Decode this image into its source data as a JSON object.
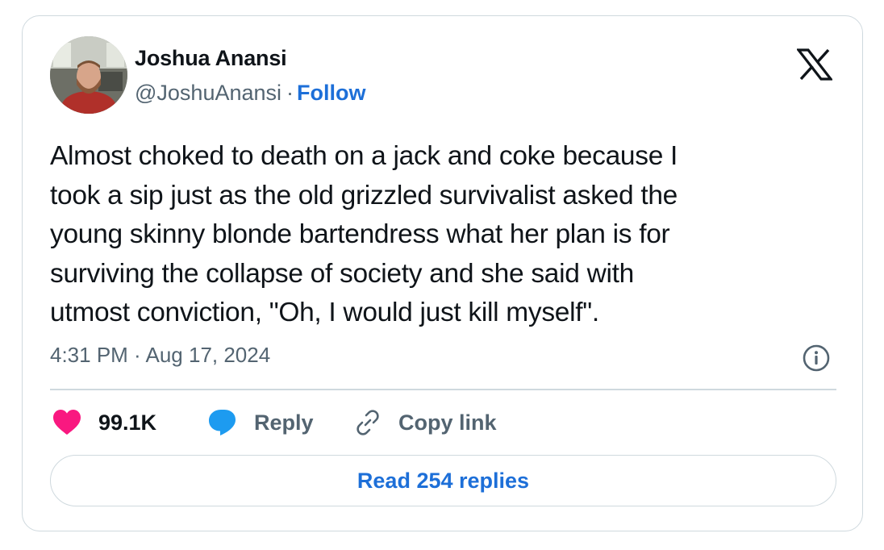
{
  "tweet": {
    "author": {
      "name": "Joshua Anansi",
      "handle": "@JoshuAnansi",
      "separator": "·",
      "follow_label": "Follow",
      "avatar_icon": "profile-photo"
    },
    "platform_icon": "x-logo-icon",
    "text": "Almost choked to death on a jack and coke because I\ntook a sip just as the old grizzled survivalist asked the\nyoung skinny blonde bartendress what her plan is for\nsurviving the collapse of society and she said with\nutmost conviction, \"Oh, I would just kill myself\".",
    "timestamp": "4:31 PM · Aug 17, 2024",
    "actions": {
      "likes": "99.1K",
      "reply_label": "Reply",
      "copy_link_label": "Copy link"
    },
    "read_replies_label": "Read 254 replies"
  },
  "colors": {
    "accent_blue": "#1d6fd8",
    "like_pink": "#f91880",
    "reply_blue": "#1d9bf0",
    "secondary_text": "#536471",
    "border": "#cfd9de"
  }
}
